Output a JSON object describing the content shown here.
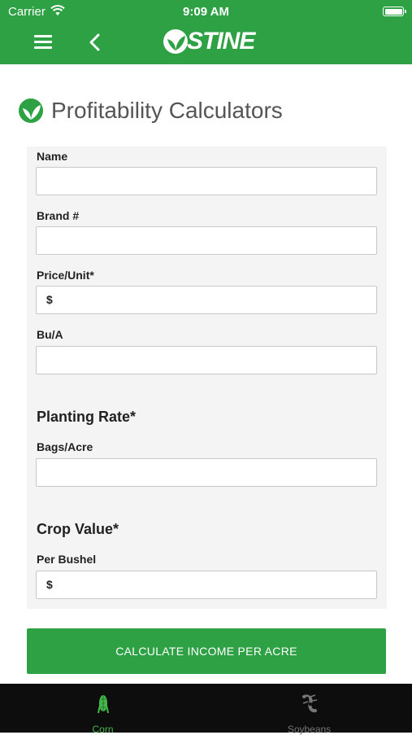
{
  "status_bar": {
    "carrier": "Carrier",
    "time": "9:09 AM"
  },
  "header": {
    "logo_text": "STINE",
    "brand_color": "#2ea145"
  },
  "page": {
    "title": "Profitability Calculators"
  },
  "form": {
    "name_label": "Name",
    "name_value": "",
    "brand_label": "Brand #",
    "brand_value": "",
    "price_label": "Price/Unit*",
    "price_prefix": "$",
    "price_value": "",
    "bua_label": "Bu/A",
    "bua_value": "",
    "planting_rate_heading": "Planting Rate*",
    "bags_label": "Bags/Acre",
    "bags_value": "",
    "crop_value_heading": "Crop Value*",
    "bushel_label": "Per Bushel",
    "bushel_prefix": "$",
    "bushel_value": ""
  },
  "actions": {
    "calculate_label": "CALCULATE INCOME PER ACRE"
  },
  "tabs": [
    {
      "label": "Corn",
      "icon": "corn-icon",
      "active": true
    },
    {
      "label": "Soybeans",
      "icon": "soybean-icon",
      "active": false
    }
  ],
  "icons": {
    "menu": "hamburger-icon",
    "back": "chevron-left-icon",
    "wifi": "wifi-icon",
    "battery": "battery-icon"
  }
}
